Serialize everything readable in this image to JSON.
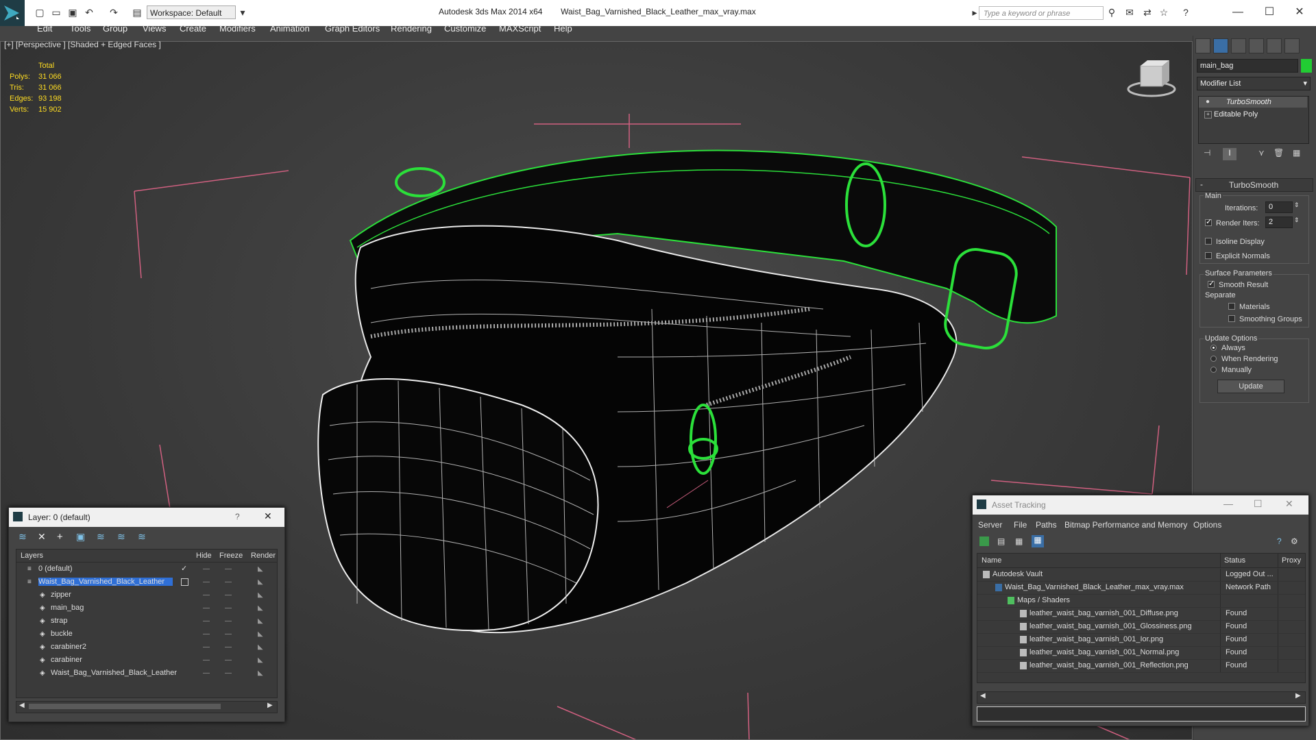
{
  "window": {
    "app_title": "Autodesk 3ds Max  2014 x64",
    "file_title": "Waist_Bag_Varnished_Black_Leather_max_vray.max",
    "workspace": "Workspace: Default",
    "search_placeholder": "Type a keyword or phrase"
  },
  "menu": [
    "Edit",
    "Tools",
    "Group",
    "Views",
    "Create",
    "Modifiers",
    "Animation",
    "Graph Editors",
    "Rendering",
    "Customize",
    "MAXScript",
    "Help"
  ],
  "viewport": {
    "label": "[+] [Perspective ] [Shaded + Edged Faces ]",
    "stats_header": "Total",
    "stats": [
      {
        "label": "Polys:",
        "value": "31 066"
      },
      {
        "label": "Tris:",
        "value": "31 066"
      },
      {
        "label": "Edges:",
        "value": "93 198"
      },
      {
        "label": "Verts:",
        "value": "15 902"
      }
    ]
  },
  "command_panel": {
    "object_name": "main_bag",
    "object_color": "#22cc33",
    "modifier_list": "Modifier List",
    "stack": [
      "TurboSmooth",
      "Editable Poly"
    ],
    "rollout_title": "TurboSmooth",
    "main_group": "Main",
    "iterations_label": "Iterations:",
    "iterations_value": "0",
    "render_iters_label": "Render Iters:",
    "render_iters_value": "2",
    "render_iters_checked": true,
    "isoline_label": "Isoline Display",
    "explicit_normals_label": "Explicit Normals",
    "surface_group": "Surface Parameters",
    "smooth_result_label": "Smooth Result",
    "separate_label": "Separate",
    "materials_label": "Materials",
    "smoothing_groups_label": "Smoothing Groups",
    "update_group": "Update Options",
    "update_options": [
      "Always",
      "When Rendering",
      "Manually"
    ],
    "update_selected": "Always",
    "update_button": "Update"
  },
  "layer_window": {
    "title": "Layer: 0 (default)",
    "help": "?",
    "columns": [
      "Layers",
      "Hide",
      "Freeze",
      "Render"
    ],
    "rows": [
      {
        "name": "0 (default)",
        "indent": 0
      },
      {
        "name": "Waist_Bag_Varnished_Black_Leather",
        "indent": 0,
        "selected": true
      },
      {
        "name": "zipper",
        "indent": 1
      },
      {
        "name": "main_bag",
        "indent": 1
      },
      {
        "name": "strap",
        "indent": 1
      },
      {
        "name": "buckle",
        "indent": 1
      },
      {
        "name": "carabiner2",
        "indent": 1
      },
      {
        "name": "carabiner",
        "indent": 1
      },
      {
        "name": "Waist_Bag_Varnished_Black_Leather",
        "indent": 1
      }
    ]
  },
  "asset_window": {
    "title": "Asset Tracking",
    "menu": [
      "Server",
      "File",
      "Paths",
      "Bitmap Performance and Memory",
      "Options"
    ],
    "columns": [
      "Name",
      "Status",
      "Proxy"
    ],
    "rows": [
      {
        "name": "Autodesk Vault",
        "status": "Logged Out ...",
        "indent": 0
      },
      {
        "name": "Waist_Bag_Varnished_Black_Leather_max_vray.max",
        "status": "Network Path",
        "indent": 1
      },
      {
        "name": "Maps / Shaders",
        "status": "",
        "indent": 2
      },
      {
        "name": "leather_waist_bag_varnish_001_Diffuse.png",
        "status": "Found",
        "indent": 3
      },
      {
        "name": "leather_waist_bag_varnish_001_Glossiness.png",
        "status": "Found",
        "indent": 3
      },
      {
        "name": "leather_waist_bag_varnish_001_Ior.png",
        "status": "Found",
        "indent": 3
      },
      {
        "name": "leather_waist_bag_varnish_001_Normal.png",
        "status": "Found",
        "indent": 3
      },
      {
        "name": "leather_waist_bag_varnish_001_Reflection.png",
        "status": "Found",
        "indent": 3
      }
    ]
  }
}
